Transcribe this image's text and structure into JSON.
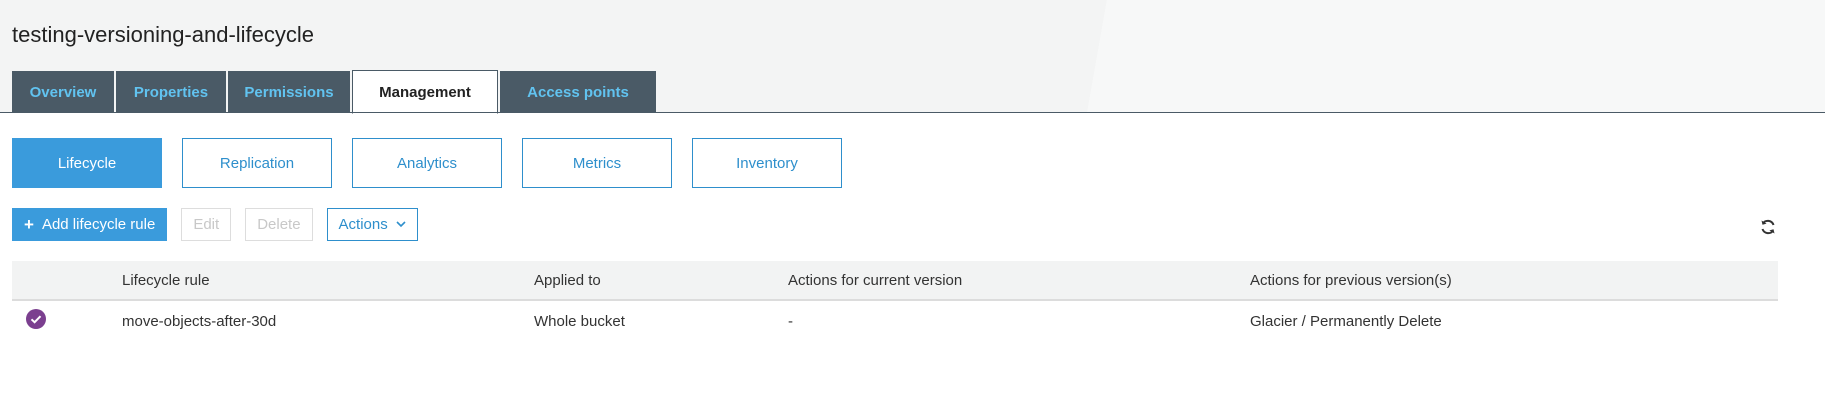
{
  "page": {
    "title": "testing-versioning-and-lifecycle"
  },
  "tabs": [
    {
      "label": "Overview"
    },
    {
      "label": "Properties"
    },
    {
      "label": "Permissions"
    },
    {
      "label": "Management"
    },
    {
      "label": "Access points"
    }
  ],
  "subtabs": [
    {
      "label": "Lifecycle"
    },
    {
      "label": "Replication"
    },
    {
      "label": "Analytics"
    },
    {
      "label": "Metrics"
    },
    {
      "label": "Inventory"
    }
  ],
  "toolbar": {
    "add_label": "Add lifecycle rule",
    "edit_label": "Edit",
    "delete_label": "Delete",
    "actions_label": "Actions"
  },
  "table": {
    "columns": [
      "Lifecycle rule",
      "Applied to",
      "Actions for current version",
      "Actions for previous version(s)"
    ],
    "rows": [
      {
        "rule": "move-objects-after-30d",
        "applied_to": "Whole bucket",
        "current": "-",
        "previous": "Glacier / Permanently Delete"
      }
    ]
  },
  "colors": {
    "accent": "#3a9bdc",
    "tab_bg": "#4a5a66",
    "tab_text": "#61c3f0",
    "status_check": "#7b3f8f"
  },
  "icons": {
    "add": "plus-icon",
    "dropdown": "chevron-down-icon",
    "refresh": "refresh-icon",
    "status": "check-circle-icon"
  }
}
